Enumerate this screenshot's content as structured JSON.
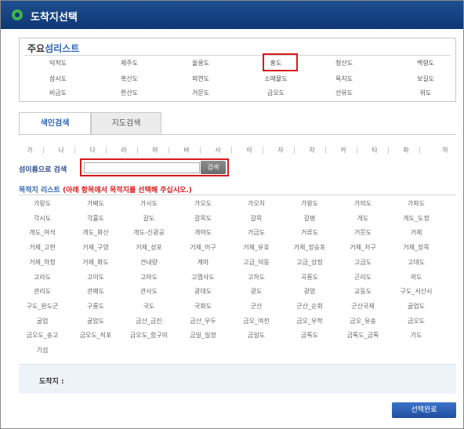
{
  "window": {
    "title": "도착지선택"
  },
  "major_islands": {
    "title_prefix": "주요",
    "title_suffix": "섬리스트",
    "items": [
      "덕적도",
      "제주도",
      "울릉도",
      "홍도",
      "청산도",
      "백령도",
      "삼시도",
      "흑산도",
      "외연도",
      "소매물도",
      "욕지도",
      "보길도",
      "비금도",
      "한산도",
      "거문도",
      "금오도",
      "선유도",
      "위도"
    ],
    "highlighted": "홍도"
  },
  "tabs": [
    {
      "label": "색인검색",
      "active": true
    },
    {
      "label": "지도검색",
      "active": false
    }
  ],
  "consonants": [
    "가",
    "나",
    "다",
    "라",
    "마",
    "바",
    "사",
    "아",
    "자",
    "차",
    "카",
    "타",
    "파",
    "하"
  ],
  "search": {
    "label": "섬이름으로 검색",
    "value": "",
    "placeholder": "",
    "button": "검색"
  },
  "destination_list": {
    "title": "목적지 리스트",
    "note": "(아래 항목에서 목적지를 선택해 주십시오.)",
    "items": [
      "가랑도",
      "가배도",
      "가사도",
      "가오도",
      "가오치",
      "가왕도",
      "가의도",
      "가파도",
      "각시도",
      "각흘도",
      "갈도",
      "갈목도",
      "갈목",
      "갈평",
      "개도",
      "개도_도정",
      "개도_여석",
      "개도_화산",
      "개도-신광공",
      "개야도",
      "거금도",
      "거류도",
      "거문도",
      "거제",
      "거제_고현",
      "거제_구영",
      "거제_성포",
      "거제_어구",
      "거제_유호",
      "거제_장승포",
      "거제_저구",
      "거제_장목",
      "거제_하청",
      "거제_화도",
      "견내량",
      "계마",
      "고금_덕동",
      "고금_상정",
      "고금도",
      "고대도",
      "고라도",
      "고이도",
      "고마도",
      "고엽사도",
      "고하도",
      "곡룡도",
      "곤리도",
      "곽도",
      "관리도",
      "관매도",
      "관사도",
      "광대도",
      "광도",
      "광양",
      "교동도",
      "구도_서산시",
      "구도_완도군",
      "구룡도",
      "국도",
      "국화도",
      "군산",
      "군산_순회",
      "군산국제",
      "굴업도",
      "굴업",
      "굴암도",
      "금산_금진",
      "금산_우두",
      "금오_여천",
      "금오_우학",
      "금오_유송",
      "금오도",
      "금오도_송고",
      "금오도_직포",
      "금오도_함구미",
      "금일_일정",
      "금일도",
      "금톡도",
      "금톡도_금톡",
      "기도",
      "기섬"
    ]
  },
  "arrival": {
    "label": "도착지 :",
    "value": ""
  },
  "confirm_button": "선택완료",
  "colors": {
    "title_bar": "#0f3774",
    "accent_blue": "#2e65b8",
    "highlight_red": "#d9191b",
    "button_blue": "#1f4e9e"
  }
}
